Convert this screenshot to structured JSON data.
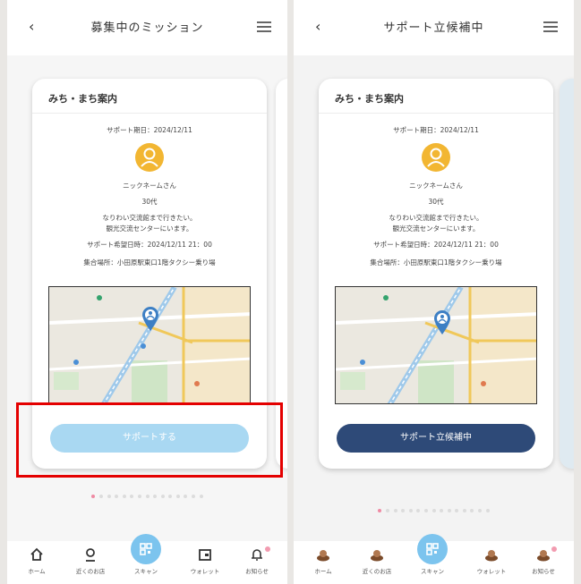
{
  "left": {
    "header_title": "募集中のミッション",
    "card": {
      "title": "みち・まち案内",
      "support_date": "サポート期日：2024/12/11",
      "nickname": "ニックネームさん",
      "age": "30代",
      "desc1": "なりわい交流館まで行きたい。",
      "desc2": "観光交流センターにいます。",
      "wish_time": "サポート希望日時：2024/12/11 21：00",
      "meeting_place": "集合場所：小田原駅東口1階タクシー乗り場",
      "button_label": "サポートする"
    },
    "pager": {
      "count": 15,
      "active": 0
    },
    "tabbar": [
      "ホーム",
      "近くのお店",
      "スキャン",
      "ウォレット",
      "お知らせ"
    ],
    "highlight_color": "#e40000"
  },
  "right": {
    "header_title": "サポート立候補中",
    "card": {
      "title": "みち・まち案内",
      "support_date": "サポート期日：2024/12/11",
      "nickname": "ニックネームさん",
      "age": "30代",
      "desc1": "なりわい交流館まで行きたい。",
      "desc2": "観光交流センターにいます。",
      "wish_time": "サポート希望日時：2024/12/11 21：00",
      "meeting_place": "集合場所：小田原駅東口1階タクシー乗り場",
      "button_label": "サポート立候補中"
    },
    "pager": {
      "count": 15,
      "active": 0
    },
    "tabbar": [
      "ホーム",
      "近くのお店",
      "スキャン",
      "ウォレット",
      "お知らせ"
    ]
  },
  "colors": {
    "accent_light": "#a9d8f2",
    "accent_dark": "#2e4a78",
    "avatar": "#f2b632",
    "dot_active": "#ef8aa3"
  }
}
